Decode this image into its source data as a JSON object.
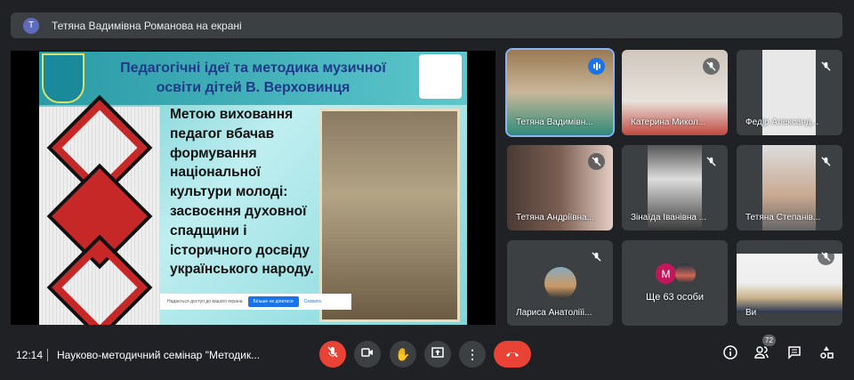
{
  "presenter_banner": {
    "avatar_letter": "Т",
    "text": "Тетяна Вадимівна Романова на екрані"
  },
  "slide": {
    "title_line1": "Педагогічні ідеї та методика музичної",
    "title_line2": "освіти дітей В. Верховинця",
    "body_lines": [
      "Метою виховання",
      "педагог вбачав",
      "формування",
      "національної",
      "культури молоді:",
      "засвоєння духовної",
      "спадщини і",
      "історичного досвіду",
      "українського народу."
    ],
    "share_notice": {
      "text": "Надається доступ до вашого екрана",
      "stop_label": "Більше не ділитися",
      "hide_label": "Сховати"
    }
  },
  "tiles": [
    {
      "name": "Тетяна Вадимівн...",
      "state": "speaking"
    },
    {
      "name": "Катерина Микол...",
      "state": "muted"
    },
    {
      "name": "Федір Александ...",
      "state": "muted"
    },
    {
      "name": "Тетяна Андріївна...",
      "state": "muted"
    },
    {
      "name": "Зінаїда Іванівна ...",
      "state": "muted"
    },
    {
      "name": "Тетяна Степанів...",
      "state": "muted"
    },
    {
      "name": "Лариса Анатоліїі...",
      "state": "muted"
    },
    {
      "name": "Ще 63 особи",
      "avatar_letter": "М"
    },
    {
      "name": "Ви",
      "state": "muted"
    }
  ],
  "bottom": {
    "time": "12:14",
    "meeting_name": "Науково-методичний семінар \"Методик...",
    "participants_count": "72"
  },
  "colors": {
    "end_call": "#ea4335",
    "accent": "#1a73e8",
    "bg": "#202124"
  }
}
